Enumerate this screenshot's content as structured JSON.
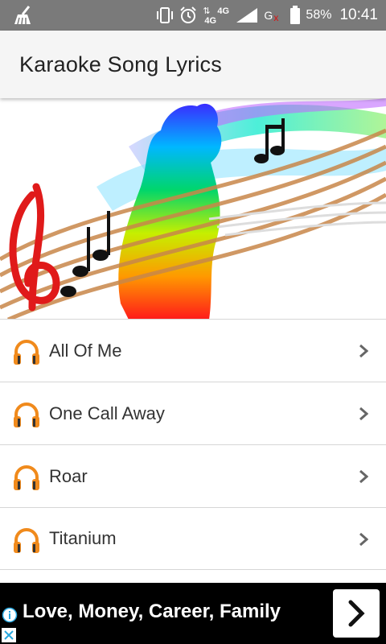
{
  "status_bar": {
    "left_icon": "broom-cleaner-icon",
    "vibrate_icon": "vibrate-icon",
    "alarm_icon": "alarm-clock-icon",
    "network_label_up": "4G",
    "network_label": "4G",
    "signal_icon": "signal-icon",
    "carrier_label": "G",
    "carrier_mark": "x",
    "battery_icon": "battery-icon",
    "battery_percent": "58%",
    "time": "10:41"
  },
  "app_bar": {
    "title": "Karaoke Song Lyrics"
  },
  "banner": {
    "image": "music-notes-singer-silhouette"
  },
  "songs": [
    {
      "title": "All Of Me",
      "icon": "headphones-icon"
    },
    {
      "title": "One Call Away",
      "icon": "headphones-icon"
    },
    {
      "title": "Roar",
      "icon": "headphones-icon"
    },
    {
      "title": "Titanium",
      "icon": "headphones-icon"
    }
  ],
  "ad": {
    "text": "Love, Money, Career, Family",
    "info_icon": "info-icon",
    "close_icon": "close-icon",
    "button_icon": "chevron-right-icon"
  },
  "colors": {
    "status_bar": "#7a7a7a",
    "app_bar": "#f5f5f5",
    "headphone_orange": "#f08a1c",
    "divider": "#d6d6d6",
    "ad_bg": "#000000",
    "ad_info": "#29a8e0"
  }
}
